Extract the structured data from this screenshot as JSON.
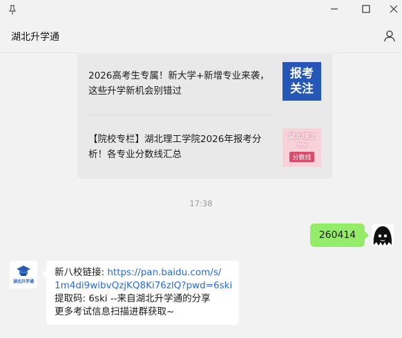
{
  "window": {
    "title": "湖北升学通",
    "icons": [
      "pin-icon",
      "minimize-icon",
      "maximize-icon",
      "close-icon",
      "user-icon"
    ]
  },
  "articles": [
    {
      "text": "2026高考生专属！新大学+新增专业来袭，这些升学新机会别错过",
      "thumb_text": [
        "报考",
        "关注"
      ],
      "thumb_color": "#2557b5"
    },
    {
      "text": "【院校专栏】湖北理工学院2026年报考分析！各专业分数线汇总",
      "thumb_text": [
        "湖北理工",
        "学院",
        "分数线"
      ],
      "thumb_color": "#f7d3d9"
    }
  ],
  "time": "17:38",
  "outgoing": {
    "text": "260414",
    "color": "#95ec69"
  },
  "incoming": {
    "avatar_label": "湖北升学通",
    "prefix": "新八校链接: ",
    "link_line1": "https://pan.baidu.com/s/",
    "link_line2": "1m4di9wibvQzjKQ8Ki76zlQ?pwd=6ski",
    "line3": "提取码: 6ski --来自湖北升学通的分享",
    "line4": "更多考试信息扫描进群获取~"
  }
}
